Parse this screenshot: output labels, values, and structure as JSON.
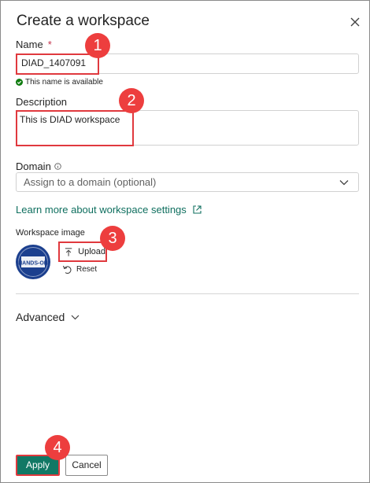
{
  "dialog": {
    "title": "Create a workspace"
  },
  "name_field": {
    "label": "Name",
    "required_mark": "*",
    "value": "DIAD_1407091",
    "availability": "This name is available"
  },
  "description_field": {
    "label": "Description",
    "value": "This is DIAD workspace"
  },
  "domain_field": {
    "label": "Domain",
    "placeholder": "Assign to a domain (optional)"
  },
  "learn_more": {
    "text": "Learn more about workspace settings"
  },
  "workspace_image": {
    "label": "Workspace image",
    "upload_label": "Upload",
    "reset_label": "Reset",
    "logo_text": "HANDS-ON"
  },
  "advanced": {
    "label": "Advanced"
  },
  "footer": {
    "apply_label": "Apply",
    "cancel_label": "Cancel"
  },
  "callouts": [
    "1",
    "2",
    "3",
    "4"
  ],
  "colors": {
    "accent": "#117865",
    "callout": "#ed3e3e",
    "success": "#107c10",
    "link": "#0f6f5f"
  }
}
